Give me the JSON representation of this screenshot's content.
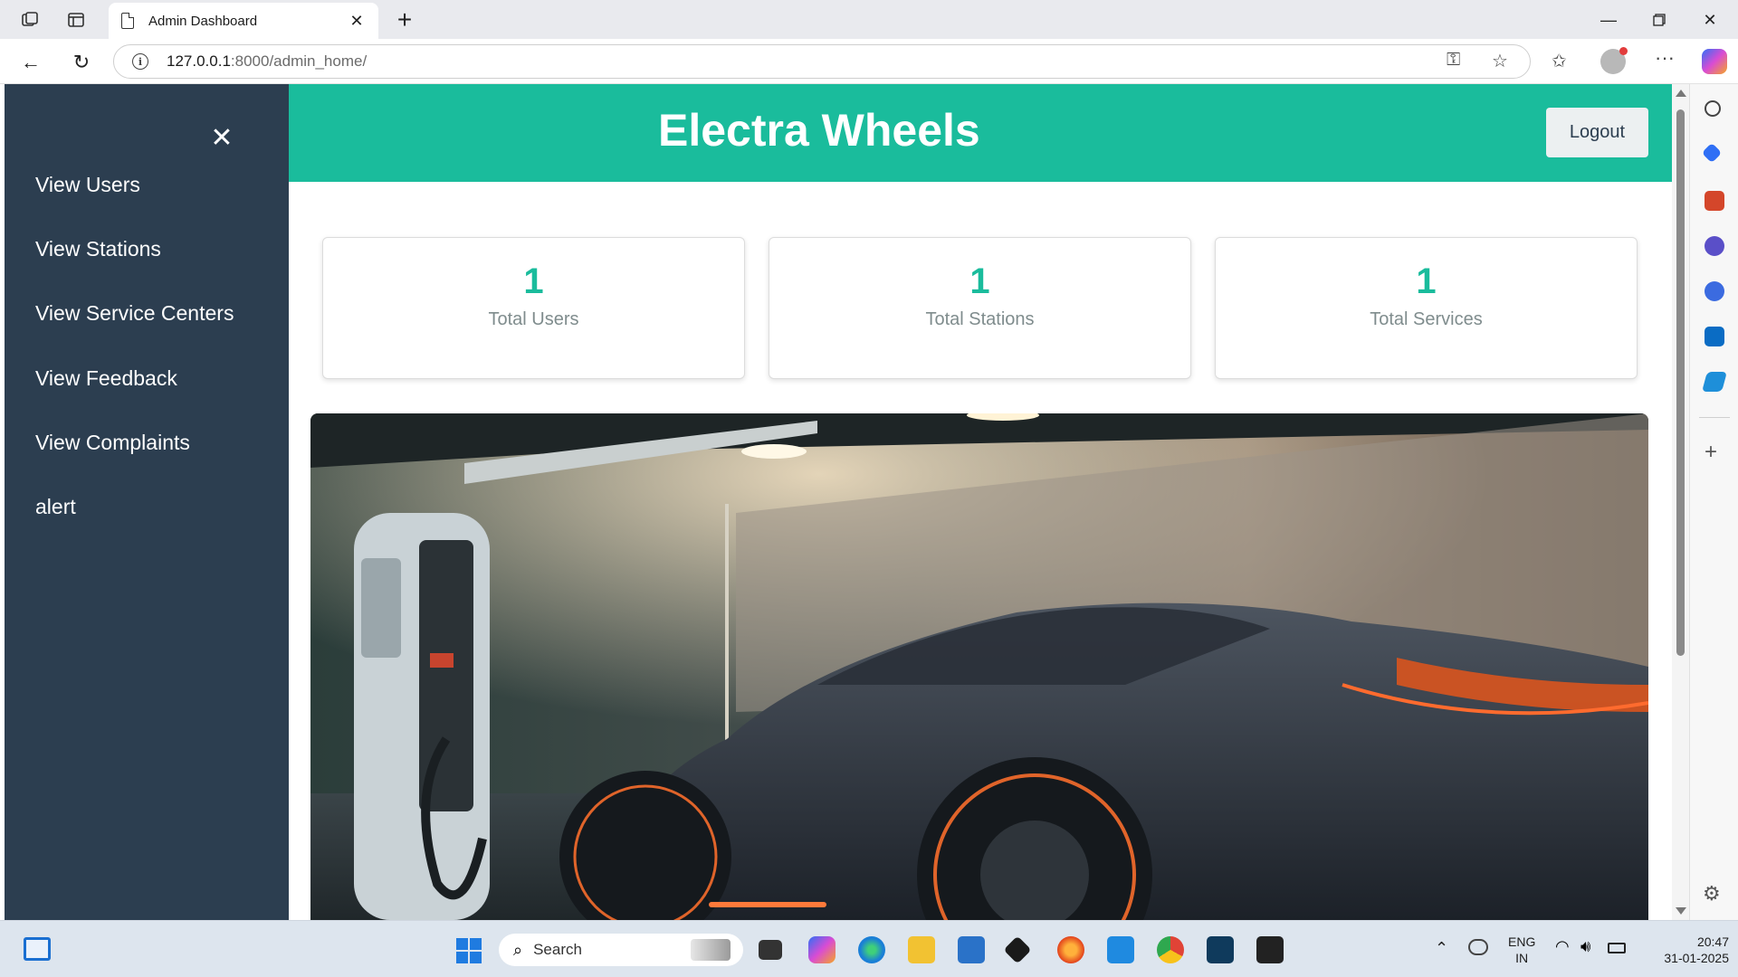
{
  "browser": {
    "tab_title": "Admin Dashboard",
    "url_host": "127.0.0.1",
    "url_rest": ":8000/admin_home/"
  },
  "app": {
    "brand": "Electra Wheels",
    "logout_label": "Logout",
    "close_glyph": "✕",
    "nav_items": [
      {
        "label": "View Users"
      },
      {
        "label": "View Stations"
      },
      {
        "label": "View Service Centers"
      },
      {
        "label": "View Feedback"
      },
      {
        "label": "View Complaints"
      },
      {
        "label": "alert"
      }
    ],
    "stats": [
      {
        "value": "1",
        "label": "Total Users"
      },
      {
        "value": "1",
        "label": "Total Stations"
      },
      {
        "value": "1",
        "label": "Total Services"
      }
    ],
    "colors": {
      "sidebar": "#2c3e50",
      "header": "#1abc9c",
      "accent": "#1abc9c"
    }
  },
  "taskbar": {
    "search_label": "Search",
    "language": "ENG",
    "region": "IN",
    "time": "20:47",
    "date": "31-01-2025"
  }
}
